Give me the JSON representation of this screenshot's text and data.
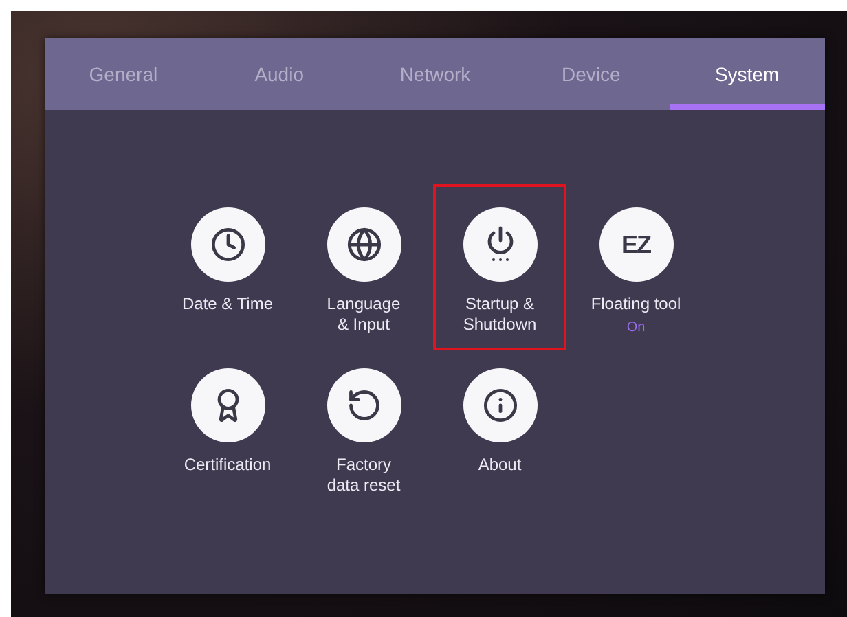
{
  "tabs": [
    {
      "label": "General",
      "selected": false
    },
    {
      "label": "Audio",
      "selected": false
    },
    {
      "label": "Network",
      "selected": false
    },
    {
      "label": "Device",
      "selected": false
    },
    {
      "label": "System",
      "selected": true
    }
  ],
  "items": [
    {
      "kind": "clock",
      "label": "Date & Time",
      "highlighted": false
    },
    {
      "kind": "globe",
      "label": "Language\n& Input",
      "highlighted": false
    },
    {
      "kind": "power",
      "label": "Startup &\nShutdown",
      "highlighted": true
    },
    {
      "kind": "ez",
      "logo_text": "EZ",
      "label": "Floating tool",
      "status": "On",
      "highlighted": false
    },
    {
      "kind": "award",
      "label": "Certification",
      "highlighted": false
    },
    {
      "kind": "reset",
      "label": "Factory\ndata reset",
      "highlighted": false
    },
    {
      "kind": "info",
      "label": "About",
      "highlighted": false
    }
  ]
}
